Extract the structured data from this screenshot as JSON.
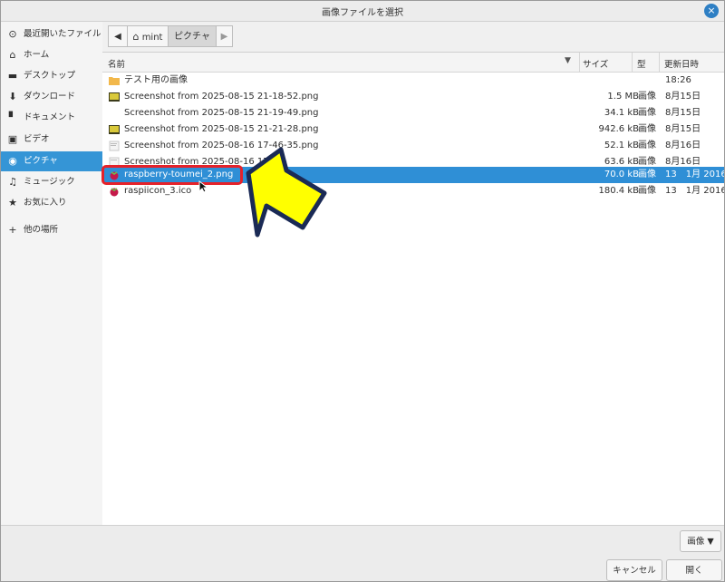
{
  "window": {
    "title": "画像ファイルを選択",
    "close_icon": "×"
  },
  "sidebar": {
    "items": [
      {
        "icon": "⊙",
        "label": "最近開いたファイル"
      },
      {
        "icon": "⌂",
        "label": "ホーム"
      },
      {
        "icon": "▬",
        "label": "デスクトップ"
      },
      {
        "icon": "⬇",
        "label": "ダウンロード"
      },
      {
        "icon": "▘",
        "label": "ドキュメント"
      },
      {
        "icon": "▣",
        "label": "ビデオ"
      },
      {
        "icon": "◉",
        "label": "ピクチャ"
      },
      {
        "icon": "♫",
        "label": "ミュージック"
      },
      {
        "icon": "★",
        "label": "お気に入り"
      },
      {
        "icon": "+",
        "label": "他の場所"
      }
    ]
  },
  "pathbar": {
    "back": "◀",
    "home_crumb": "mint",
    "current_crumb": "ピクチャ",
    "forward": "▶"
  },
  "columns": {
    "name": "名前",
    "size": "サイズ",
    "type": "型",
    "modified": "更新日時"
  },
  "files": [
    {
      "name": "テスト用の画像",
      "size": "",
      "type": "",
      "date": "18:26",
      "kind": "folder"
    },
    {
      "name": "Screenshot from 2025-08-15 21-18-52.png",
      "size": "1.5 MB",
      "type": "画像",
      "date": "8月15日",
      "kind": "image"
    },
    {
      "name": "Screenshot from 2025-08-15 21-19-49.png",
      "size": "34.1 kB",
      "type": "画像",
      "date": "8月15日",
      "kind": "blank"
    },
    {
      "name": "Screenshot from 2025-08-15 21-21-28.png",
      "size": "942.6 kB",
      "type": "画像",
      "date": "8月15日",
      "kind": "image"
    },
    {
      "name": "Screenshot from 2025-08-16 17-46-35.png",
      "size": "52.1 kB",
      "type": "画像",
      "date": "8月16日",
      "kind": "doc"
    },
    {
      "name": "Screenshot from 2025-08-16 17-47-",
      "size": "63.6 kB",
      "type": "画像",
      "date": "8月16日",
      "kind": "doc"
    },
    {
      "name": "raspberry-toumei_2.png",
      "size": "70.0 kB",
      "type": "画像",
      "date": "13　1月 2016",
      "kind": "rasp"
    },
    {
      "name": "raspiicon_3.ico",
      "size": "180.4 kB",
      "type": "画像",
      "date": "13　1月 2016",
      "kind": "rasp"
    }
  ],
  "filter": {
    "label": "画像",
    "arrow": "▼"
  },
  "buttons": {
    "cancel": "キャンセル",
    "open": "開く"
  },
  "colors": {
    "accent": "#2f8fd6",
    "highlight": "#e5222a",
    "arrow_fill": "#ffff00",
    "arrow_stroke": "#1a2a55"
  }
}
